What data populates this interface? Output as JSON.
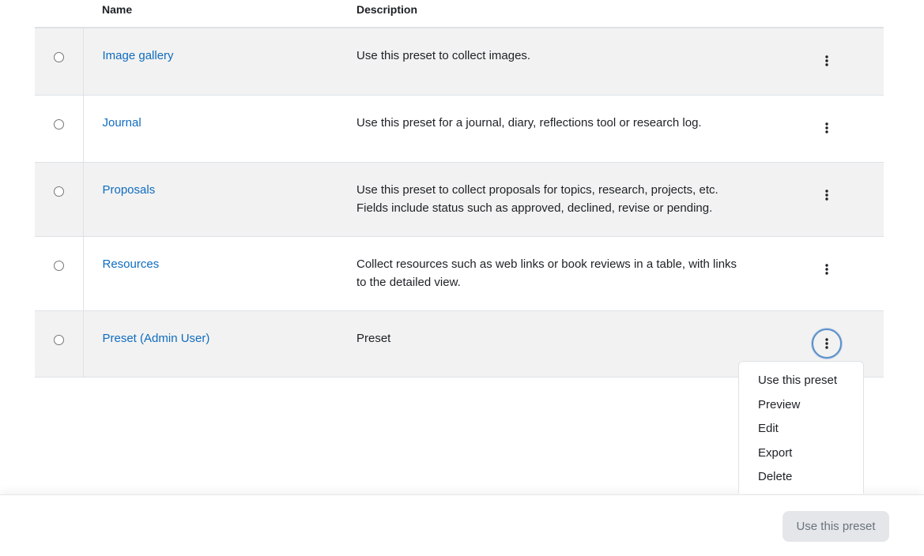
{
  "table": {
    "headers": {
      "name": "Name",
      "description": "Description"
    },
    "rows": [
      {
        "name": "Image gallery",
        "description": "Use this preset to collect images."
      },
      {
        "name": "Journal",
        "description": "Use this preset for a journal, diary, reflections tool or research log."
      },
      {
        "name": "Proposals",
        "description": "Use this preset to collect proposals for topics, research, projects, etc. Fields include status such as approved, declined, revise or pending."
      },
      {
        "name": "Resources",
        "description": "Collect resources such as web links or book reviews in a table, with links to the detailed view."
      },
      {
        "name": "Preset (Admin User)",
        "description": "Preset"
      }
    ]
  },
  "actions_menu": {
    "items": [
      "Use this preset",
      "Preview",
      "Edit",
      "Export",
      "Delete"
    ]
  },
  "footer": {
    "use_preset_label": "Use this preset"
  },
  "icons": {
    "row_actions": "kebab-menu-icon"
  },
  "colors": {
    "link": "#0f6cbf",
    "row_shade": "#f2f2f2",
    "focus_ring": "#5b8fc7",
    "disabled_button_bg": "#e4e6ea"
  }
}
